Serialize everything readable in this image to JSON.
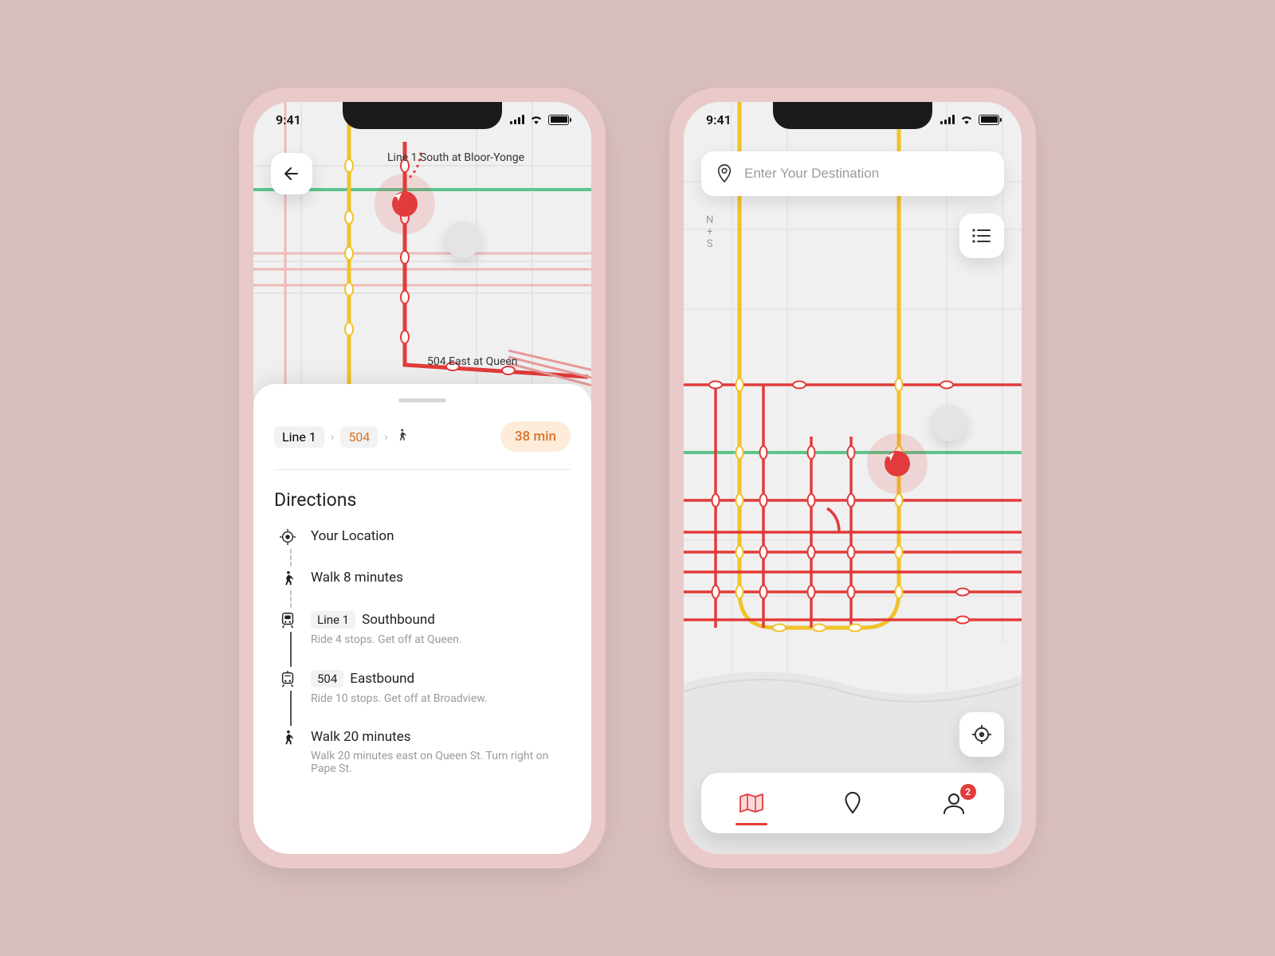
{
  "status": {
    "time": "9:41"
  },
  "left": {
    "map_labels": {
      "line1_stop": "Line 1 South at Bloor-Yonge",
      "queen_stop": "504 East at Queen"
    },
    "route_sequence": {
      "a": "Line 1",
      "b": "504",
      "walk_icon": "walk"
    },
    "eta": "38 min",
    "directions_title": "Directions",
    "steps": [
      {
        "icon": "locate",
        "main": "Your Location"
      },
      {
        "icon": "walk",
        "main": "Walk 8 minutes"
      },
      {
        "icon": "subway",
        "tag": "Line 1",
        "dir": "Southbound",
        "sub": "Ride 4 stops. Get off at Queen."
      },
      {
        "icon": "streetcar",
        "tag": "504",
        "dir": "Eastbound",
        "sub": "Ride 10 stops. Get off at Broadview."
      },
      {
        "icon": "walk",
        "main": "Walk 20 minutes",
        "sub": "Walk 20 minutes east on Queen St. Turn right on Pape St."
      }
    ]
  },
  "right": {
    "search_placeholder": "Enter Your Destination",
    "compass": {
      "n": "N",
      "plus": "+",
      "s": "S"
    },
    "profile_badge": "2"
  }
}
